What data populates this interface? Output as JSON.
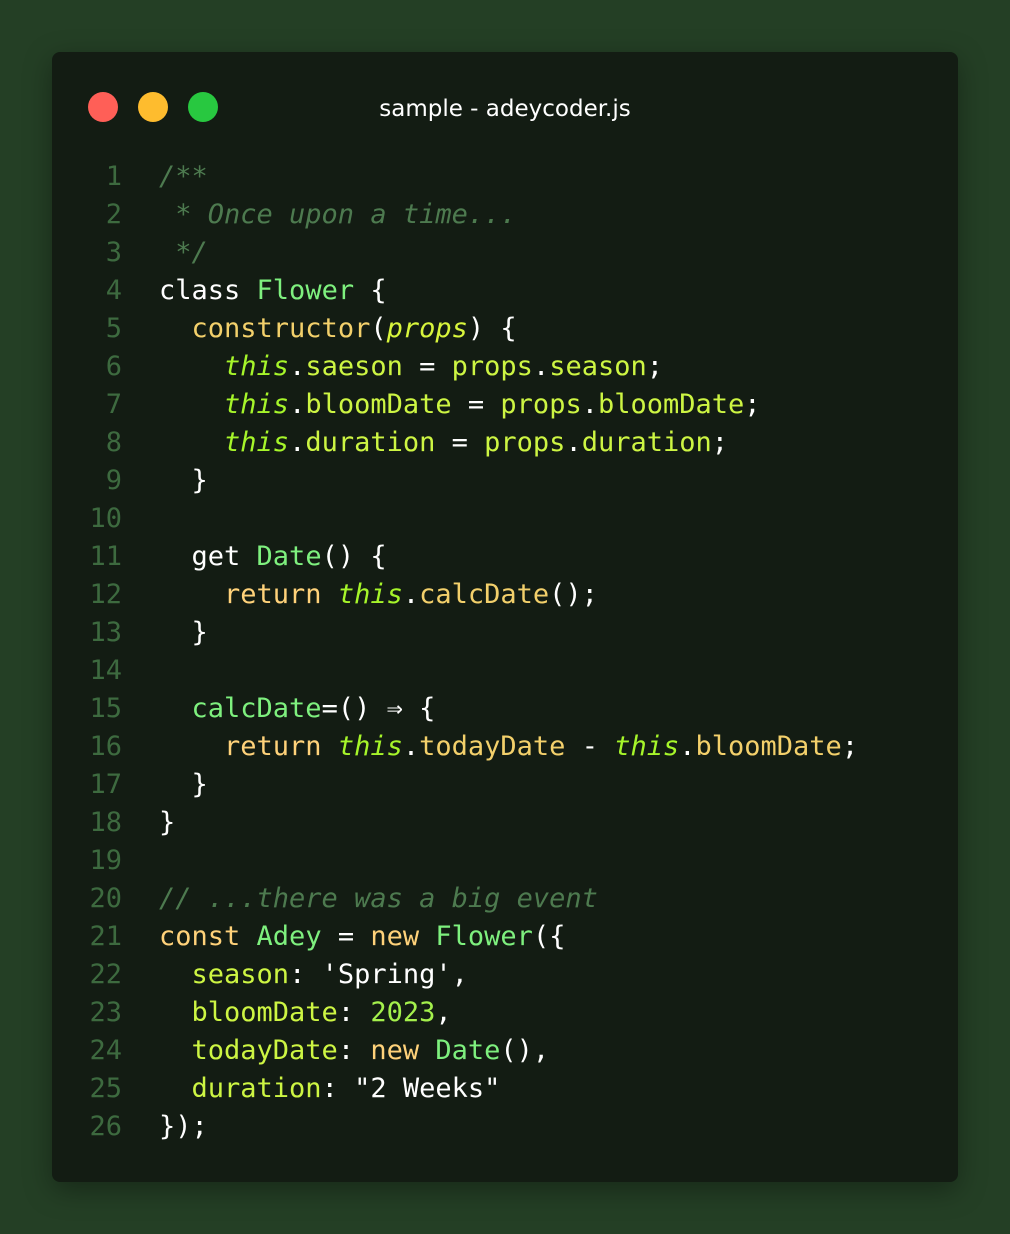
{
  "window": {
    "title": "sample - adeycoder.js",
    "buttons": {
      "close_color": "#ff5f57",
      "minimize_color": "#febc2e",
      "maximize_color": "#28c840"
    }
  },
  "editor": {
    "language": "javascript",
    "lines": [
      {
        "n": "1",
        "tokens": [
          {
            "t": "/**",
            "c": "cm"
          }
        ]
      },
      {
        "n": "2",
        "tokens": [
          {
            "t": " * Once upon a time...",
            "c": "cm"
          }
        ]
      },
      {
        "n": "3",
        "tokens": [
          {
            "t": " */",
            "c": "cm"
          }
        ]
      },
      {
        "n": "4",
        "tokens": [
          {
            "t": "class ",
            "c": "kw"
          },
          {
            "t": "Flower",
            "c": "cls"
          },
          {
            "t": " {",
            "c": "pn"
          }
        ]
      },
      {
        "n": "5",
        "tokens": [
          {
            "t": "  ",
            "c": "pn"
          },
          {
            "t": "constructor",
            "c": "fn"
          },
          {
            "t": "(",
            "c": "pn"
          },
          {
            "t": "props",
            "c": "prm"
          },
          {
            "t": ") {",
            "c": "pn"
          }
        ]
      },
      {
        "n": "6",
        "tokens": [
          {
            "t": "    ",
            "c": "pn"
          },
          {
            "t": "this",
            "c": "ths"
          },
          {
            "t": ".",
            "c": "pn"
          },
          {
            "t": "saeson",
            "c": "prop"
          },
          {
            "t": " = ",
            "c": "op"
          },
          {
            "t": "props",
            "c": "prop"
          },
          {
            "t": ".",
            "c": "pn"
          },
          {
            "t": "season",
            "c": "prop"
          },
          {
            "t": ";",
            "c": "pn"
          }
        ]
      },
      {
        "n": "7",
        "tokens": [
          {
            "t": "    ",
            "c": "pn"
          },
          {
            "t": "this",
            "c": "ths"
          },
          {
            "t": ".",
            "c": "pn"
          },
          {
            "t": "bloomDate",
            "c": "prop"
          },
          {
            "t": " = ",
            "c": "op"
          },
          {
            "t": "props",
            "c": "prop"
          },
          {
            "t": ".",
            "c": "pn"
          },
          {
            "t": "bloomDate",
            "c": "prop"
          },
          {
            "t": ";",
            "c": "pn"
          }
        ]
      },
      {
        "n": "8",
        "tokens": [
          {
            "t": "    ",
            "c": "pn"
          },
          {
            "t": "this",
            "c": "ths"
          },
          {
            "t": ".",
            "c": "pn"
          },
          {
            "t": "duration",
            "c": "prop"
          },
          {
            "t": " = ",
            "c": "op"
          },
          {
            "t": "props",
            "c": "prop"
          },
          {
            "t": ".",
            "c": "pn"
          },
          {
            "t": "duration",
            "c": "prop"
          },
          {
            "t": ";",
            "c": "pn"
          }
        ]
      },
      {
        "n": "9",
        "tokens": [
          {
            "t": "  }",
            "c": "pn"
          }
        ]
      },
      {
        "n": "10",
        "tokens": []
      },
      {
        "n": "11",
        "tokens": [
          {
            "t": "  get ",
            "c": "kw"
          },
          {
            "t": "Date",
            "c": "cls"
          },
          {
            "t": "() {",
            "c": "pn"
          }
        ]
      },
      {
        "n": "12",
        "tokens": [
          {
            "t": "    ",
            "c": "pn"
          },
          {
            "t": "return ",
            "c": "ret"
          },
          {
            "t": "this",
            "c": "ths"
          },
          {
            "t": ".",
            "c": "pn"
          },
          {
            "t": "calcDate",
            "c": "fn"
          },
          {
            "t": "();",
            "c": "pn"
          }
        ]
      },
      {
        "n": "13",
        "tokens": [
          {
            "t": "  }",
            "c": "pn"
          }
        ]
      },
      {
        "n": "14",
        "tokens": []
      },
      {
        "n": "15",
        "tokens": [
          {
            "t": "  ",
            "c": "pn"
          },
          {
            "t": "calcDate",
            "c": "cls"
          },
          {
            "t": "=() ⇒ {",
            "c": "pn"
          }
        ]
      },
      {
        "n": "16",
        "tokens": [
          {
            "t": "    ",
            "c": "pn"
          },
          {
            "t": "return ",
            "c": "ret"
          },
          {
            "t": "this",
            "c": "ths"
          },
          {
            "t": ".",
            "c": "pn"
          },
          {
            "t": "todayDate",
            "c": "fn"
          },
          {
            "t": " - ",
            "c": "op"
          },
          {
            "t": "this",
            "c": "ths"
          },
          {
            "t": ".",
            "c": "pn"
          },
          {
            "t": "bloomDate",
            "c": "fn"
          },
          {
            "t": ";",
            "c": "pn"
          }
        ]
      },
      {
        "n": "17",
        "tokens": [
          {
            "t": "  }",
            "c": "pn"
          }
        ]
      },
      {
        "n": "18",
        "tokens": [
          {
            "t": "}",
            "c": "pn"
          }
        ]
      },
      {
        "n": "19",
        "tokens": []
      },
      {
        "n": "20",
        "tokens": [
          {
            "t": "// ...there was a big event",
            "c": "cm"
          }
        ]
      },
      {
        "n": "21",
        "tokens": [
          {
            "t": "const ",
            "c": "ret"
          },
          {
            "t": "Adey",
            "c": "cls"
          },
          {
            "t": " = ",
            "c": "op"
          },
          {
            "t": "new ",
            "c": "ret"
          },
          {
            "t": "Flower",
            "c": "cls"
          },
          {
            "t": "({",
            "c": "pn"
          }
        ]
      },
      {
        "n": "22",
        "tokens": [
          {
            "t": "  ",
            "c": "pn"
          },
          {
            "t": "season",
            "c": "prop"
          },
          {
            "t": ": ",
            "c": "pn"
          },
          {
            "t": "'Spring'",
            "c": "str"
          },
          {
            "t": ",",
            "c": "pn"
          }
        ]
      },
      {
        "n": "23",
        "tokens": [
          {
            "t": "  ",
            "c": "pn"
          },
          {
            "t": "bloomDate",
            "c": "prop"
          },
          {
            "t": ": ",
            "c": "pn"
          },
          {
            "t": "2023",
            "c": "num"
          },
          {
            "t": ",",
            "c": "pn"
          }
        ]
      },
      {
        "n": "24",
        "tokens": [
          {
            "t": "  ",
            "c": "pn"
          },
          {
            "t": "todayDate",
            "c": "prop"
          },
          {
            "t": ": ",
            "c": "pn"
          },
          {
            "t": "new ",
            "c": "ret"
          },
          {
            "t": "Date",
            "c": "cls"
          },
          {
            "t": "(),",
            "c": "pn"
          }
        ]
      },
      {
        "n": "25",
        "tokens": [
          {
            "t": "  ",
            "c": "pn"
          },
          {
            "t": "duration",
            "c": "prop"
          },
          {
            "t": ": ",
            "c": "pn"
          },
          {
            "t": "\"2 Weeks\"",
            "c": "str"
          }
        ]
      },
      {
        "n": "26",
        "tokens": [
          {
            "t": "});",
            "c": "pn"
          }
        ]
      }
    ]
  }
}
